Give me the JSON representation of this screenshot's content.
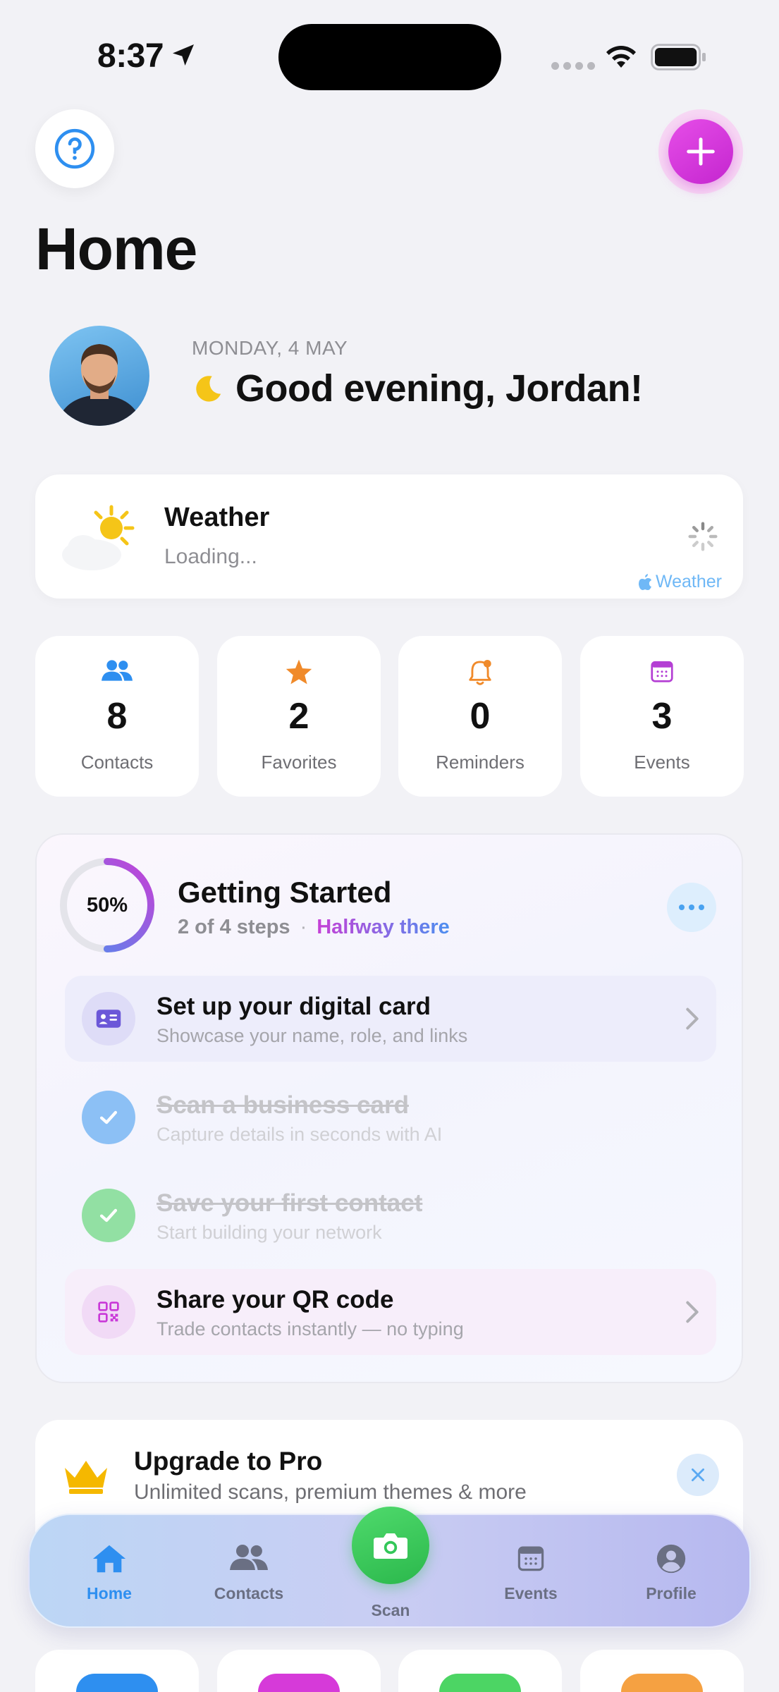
{
  "status_bar": {
    "time": "8:37"
  },
  "header": {
    "title": "Home"
  },
  "greeting": {
    "date": "MONDAY, 4 MAY",
    "message": "Good evening, Jordan!"
  },
  "weather": {
    "title": "Weather",
    "status": "Loading...",
    "brand": "Weather"
  },
  "stats": [
    {
      "value": "8",
      "label": "Contacts",
      "icon": "people-icon",
      "color": "#2e8ff0"
    },
    {
      "value": "2",
      "label": "Favorites",
      "icon": "star-icon",
      "color": "#f08a2a"
    },
    {
      "value": "0",
      "label": "Reminders",
      "icon": "bell-icon",
      "color": "#f08a2a"
    },
    {
      "value": "3",
      "label": "Events",
      "icon": "calendar-icon",
      "color": "#b43fd4"
    }
  ],
  "getting_started": {
    "progress_label": "50%",
    "progress": 0.5,
    "title": "Getting Started",
    "steps_text": "2 of 4 steps",
    "separator": "·",
    "status_text": "Halfway there",
    "tasks": [
      {
        "title": "Set up your digital card",
        "subtitle": "Showcase your name, role, and links",
        "done": false
      },
      {
        "title": "Scan a business card",
        "subtitle": "Capture details in seconds with AI",
        "done": true
      },
      {
        "title": "Save your first contact",
        "subtitle": "Start building your network",
        "done": true
      },
      {
        "title": "Share your QR code",
        "subtitle": "Trade contacts instantly — no typing",
        "done": false
      }
    ]
  },
  "upgrade": {
    "title": "Upgrade to Pro",
    "subtitle": "Unlimited scans, premium themes & more"
  },
  "tabbar": {
    "items": [
      {
        "label": "Home",
        "active": true
      },
      {
        "label": "Contacts",
        "active": false
      },
      {
        "label": "Scan",
        "active": false
      },
      {
        "label": "Events",
        "active": false
      },
      {
        "label": "Profile",
        "active": false
      }
    ]
  },
  "colors": {
    "accent": "#2e8ff0",
    "brand_magenta": "#d63ad9",
    "scan_green": "#34c759"
  }
}
